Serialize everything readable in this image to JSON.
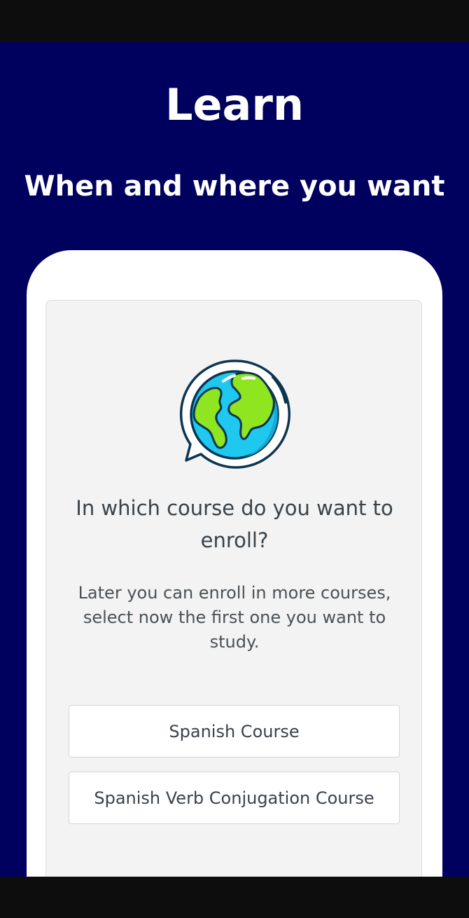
{
  "hero": {
    "title": "Learn",
    "subtitle": "When and where you want"
  },
  "enroll": {
    "icon": "globe-chat-icon",
    "question": "In which course do you want to enroll?",
    "hint": "Later you can enroll in more courses, select now the first one you want to study.",
    "courses": [
      {
        "label": "Spanish Course"
      },
      {
        "label": "Spanish Verb Conjugation Course"
      }
    ]
  },
  "colors": {
    "background": "#00005f",
    "globe_water": "#1ec8ee",
    "globe_land": "#8fe51f",
    "outline": "#0d3553"
  }
}
